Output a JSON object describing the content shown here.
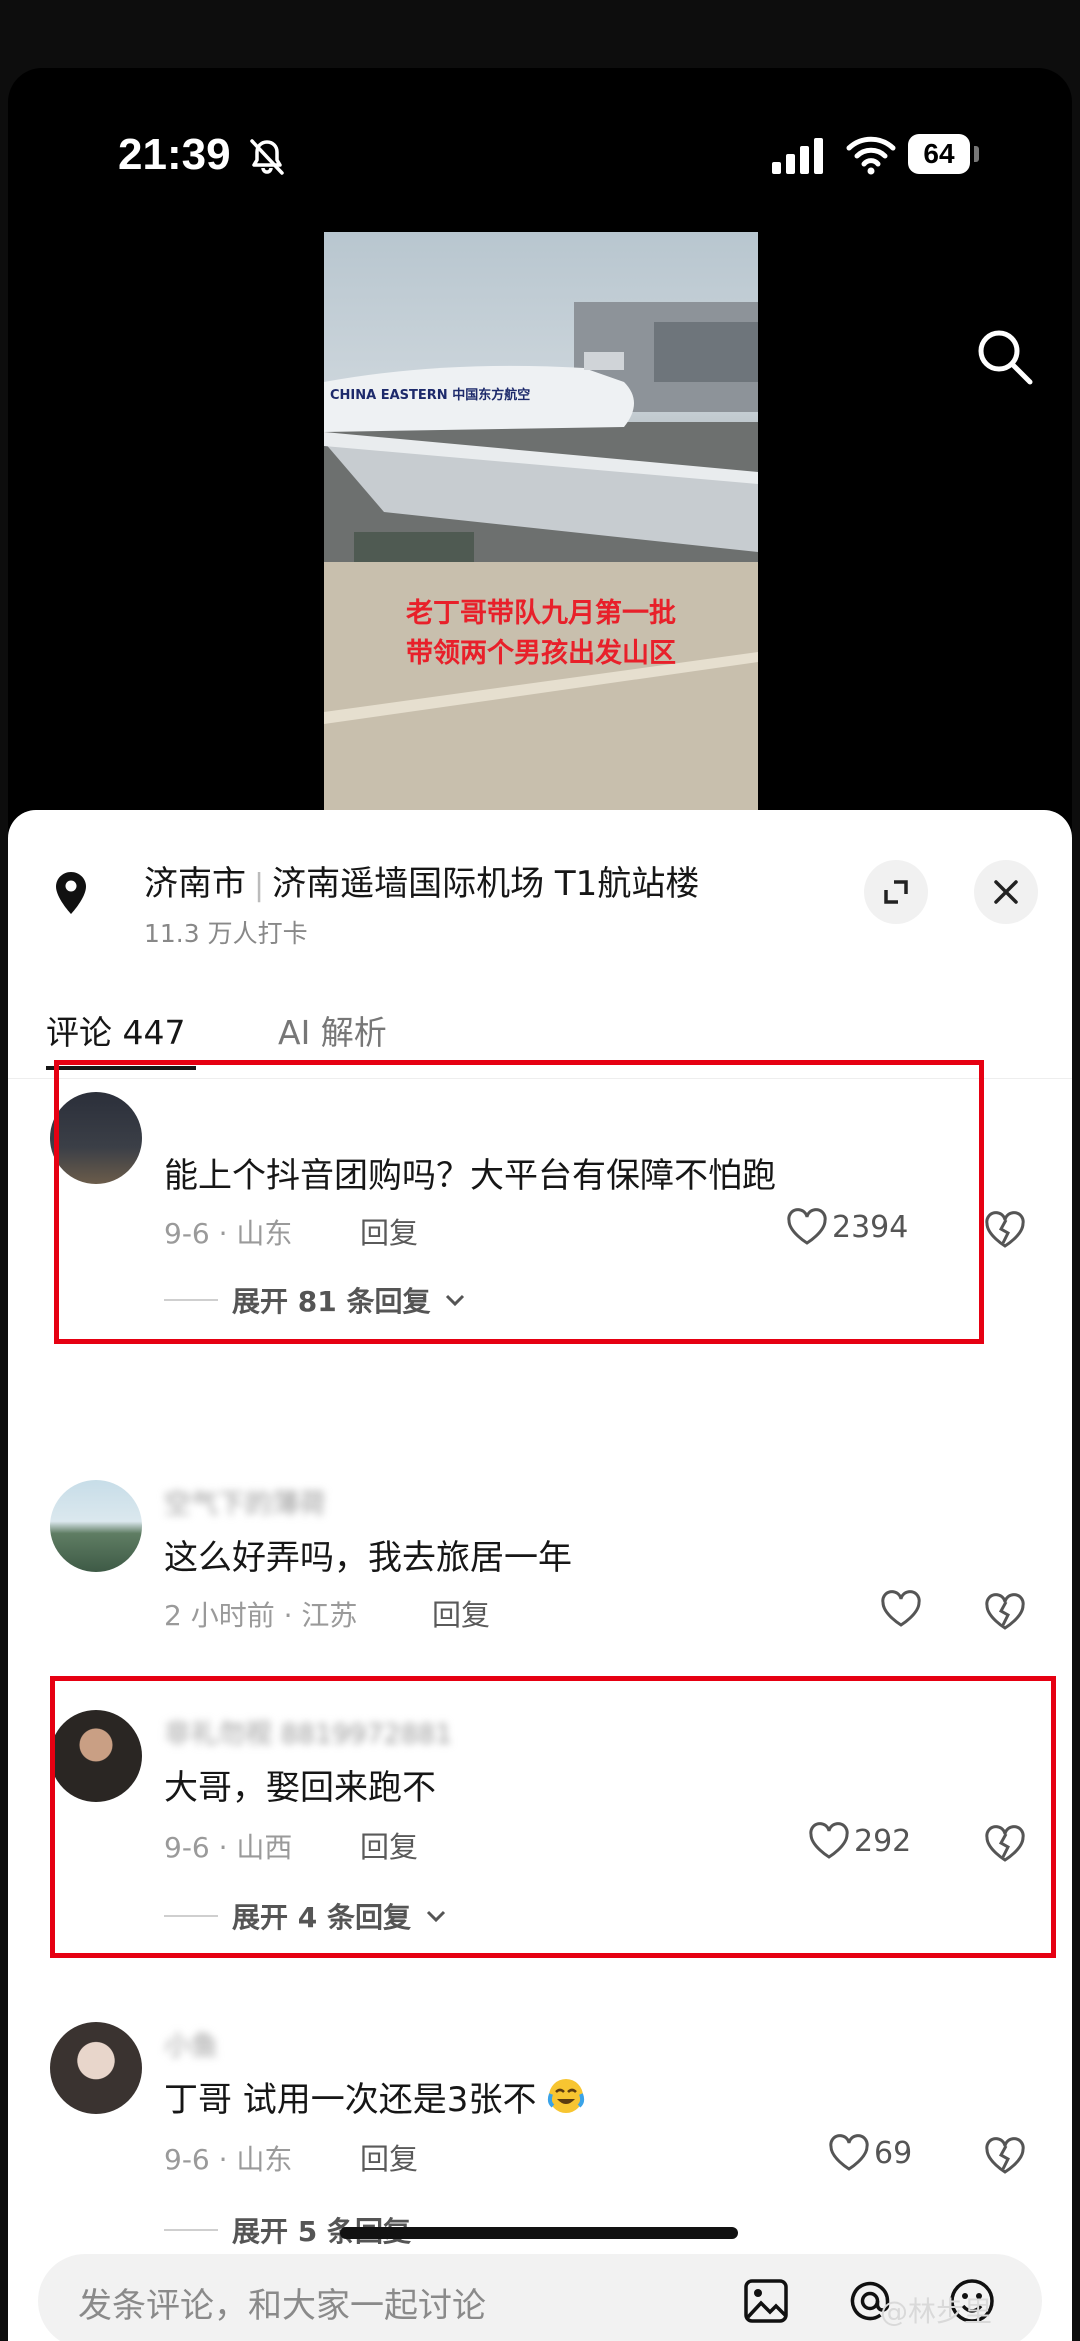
{
  "status_bar": {
    "time": "21:39",
    "battery": "64"
  },
  "video": {
    "caption_line1": "老丁哥带队九月第一批",
    "caption_line2": "带领两个男孩出发山区",
    "airline_text": "CHINA EASTERN 中国东方航空"
  },
  "location": {
    "city": "济南市",
    "place": "济南遥墙国际机场 T1航站楼",
    "checkins": "11.3 万人打卡"
  },
  "tabs": {
    "comments": "评论 447",
    "ai": "AI 解析"
  },
  "comments": [
    {
      "text": "能上个抖音团购吗？大平台有保障不怕跑",
      "meta": "9-6 · 山东",
      "reply": "回复",
      "likes": "2394",
      "expand": "展开 81 条回复",
      "highlighted": true
    },
    {
      "username": "空气下的薄荷",
      "text": "这么好弄吗，我去旅居一年",
      "meta": "2 小时前 · 江苏",
      "reply": "回复",
      "likes": "",
      "highlighted": false
    },
    {
      "username": "非礼勿视 8819972881",
      "text": "大哥，娶回来跑不",
      "meta": "9-6 · 山西",
      "reply": "回复",
      "likes": "292",
      "expand": "展开 4 条回复",
      "highlighted": true
    },
    {
      "username": "小鱼",
      "text": "丁哥 试用一次还是3张不",
      "meta": "9-6 · 山东",
      "reply": "回复",
      "likes": "69",
      "expand": "展开 5 条回复",
      "highlighted": false
    }
  ],
  "input": {
    "placeholder": "发条评论，和大家一起讨论"
  },
  "watermark": "@林步里",
  "colors": {
    "highlight": "#e60012",
    "caption": "#e8202a"
  }
}
